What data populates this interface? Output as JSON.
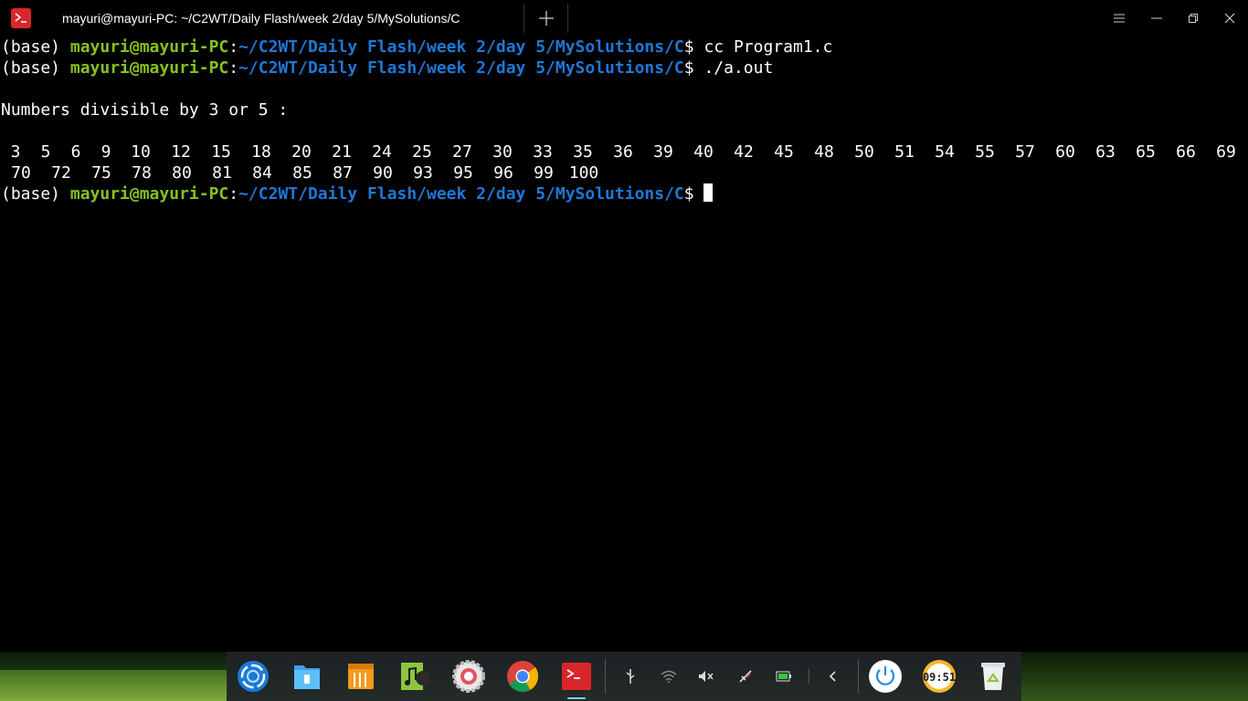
{
  "window": {
    "tab_title": "mayuri@mayuri-PC: ~/C2WT/Daily Flash/week 2/day 5/MySolutions/C"
  },
  "terminal": {
    "prompt": {
      "env": "(base) ",
      "user": "mayuri@mayuri-PC",
      "colon": ":",
      "path": "~/C2WT/Daily Flash/week 2/day 5/MySolutions/C",
      "symbol": "$ "
    },
    "commands": [
      "cc Program1.c",
      "./a.out"
    ],
    "output_heading": "Numbers divisible by 3 or 5 :",
    "numbers_row1": [
      "3",
      "5",
      "6",
      "9",
      "10",
      "12",
      "15",
      "18",
      "20",
      "21",
      "24",
      "25",
      "27",
      "30",
      "33",
      "35",
      "36",
      "39",
      "40",
      "42",
      "45",
      "48",
      "50",
      "51",
      "54",
      "55",
      "57",
      "60",
      "63",
      "65",
      "66",
      "69"
    ],
    "numbers_row2": [
      "70",
      "72",
      "75",
      "78",
      "80",
      "81",
      "84",
      "85",
      "87",
      "90",
      "93",
      "95",
      "96",
      "99",
      "100"
    ]
  },
  "colors": {
    "background": "#000000",
    "user": "#85c21e",
    "path": "#1f78d6",
    "text": "#ffffff",
    "tab_icon": "#d9262b"
  },
  "dock": {
    "apps": [
      "launcher-icon",
      "file-manager-icon",
      "app-store-icon",
      "music-icon",
      "settings-icon",
      "chrome-icon",
      "terminal-icon"
    ],
    "tray": [
      "usb-icon",
      "wifi-icon",
      "volume-muted-icon",
      "airplane-mode-icon",
      "battery-icon",
      "chevron-left-icon"
    ],
    "clock": "09:51",
    "trash": "trash-icon"
  }
}
